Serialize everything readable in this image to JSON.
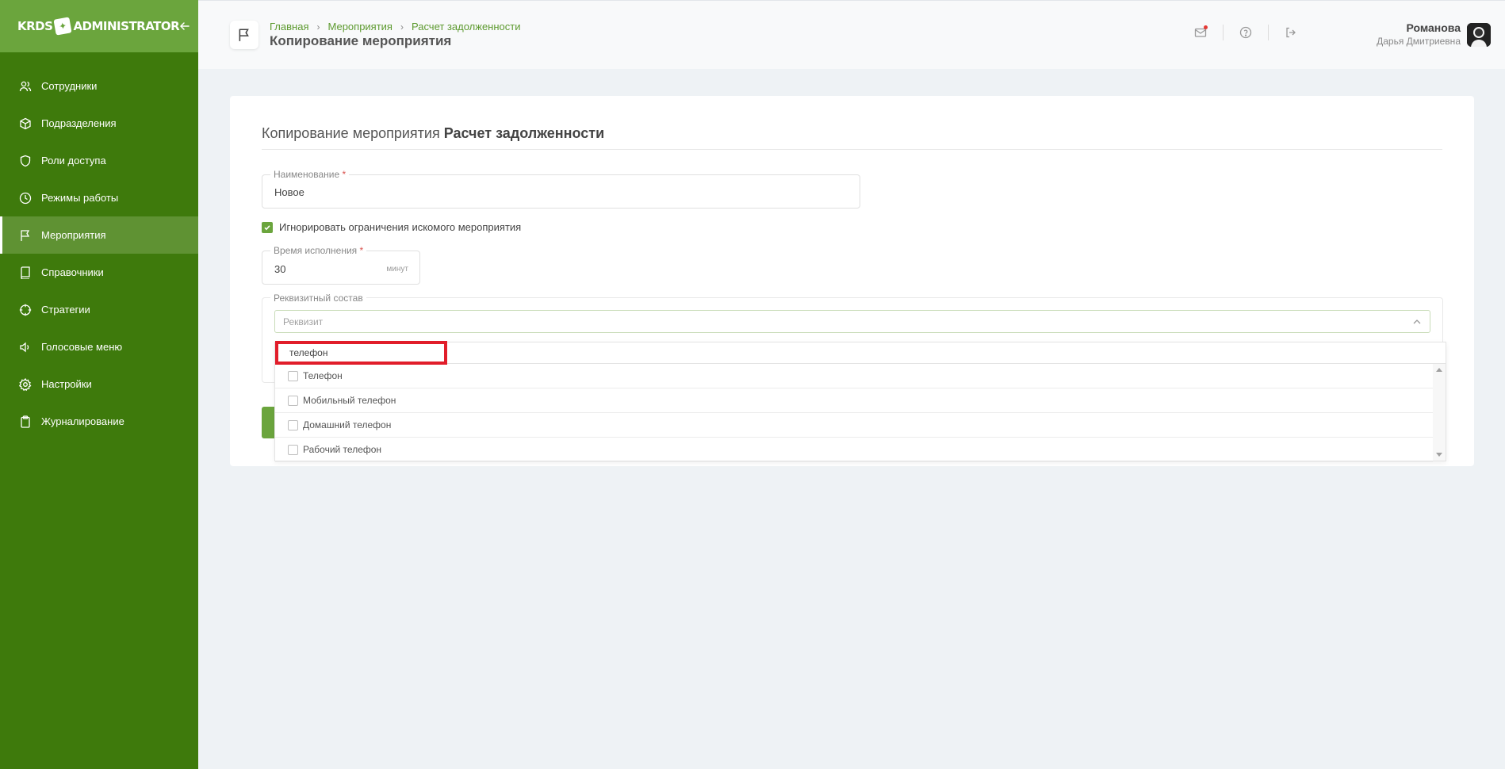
{
  "app": {
    "logo_left": "KRDS",
    "logo_right": "ADMINISTRATOR"
  },
  "sidebar": {
    "items": [
      {
        "label": "Сотрудники",
        "icon": "users-icon"
      },
      {
        "label": "Подразделения",
        "icon": "cube-icon"
      },
      {
        "label": "Роли доступа",
        "icon": "shield-icon"
      },
      {
        "label": "Режимы работы",
        "icon": "clock-icon"
      },
      {
        "label": "Мероприятия",
        "icon": "flag-icon",
        "active": true
      },
      {
        "label": "Справочники",
        "icon": "book-icon"
      },
      {
        "label": "Стратегии",
        "icon": "crosshair-icon"
      },
      {
        "label": "Голосовые меню",
        "icon": "speaker-icon"
      },
      {
        "label": "Настройки",
        "icon": "gear-icon"
      },
      {
        "label": "Журналирование",
        "icon": "clipboard-icon"
      }
    ]
  },
  "header": {
    "breadcrumbs": [
      "Главная",
      "Мероприятия",
      "Расчет задолженности"
    ],
    "title": "Копирование мероприятия",
    "user_surname": "Романова",
    "user_name": "Дарья Дмитриевна"
  },
  "form": {
    "title_prefix": "Копирование мероприятия",
    "title_bold": "Расчет задолженности",
    "name_label": "Наименование",
    "name_value": "Новое",
    "required_mark": "*",
    "ignore_label": "Игнорировать ограничения искомого мероприятия",
    "ignore_checked": true,
    "time_label": "Время исполнения",
    "time_value": "30",
    "time_unit": "минут",
    "props_legend": "Реквизитный состав",
    "props_placeholder": "Реквизит"
  },
  "dropdown": {
    "search_value": "телефон",
    "options": [
      "Телефон",
      "Мобильный телефон",
      "Домашний телефон",
      "Рабочий телефон"
    ]
  },
  "colors": {
    "sidebar_bg": "#3e7a0c",
    "sidebar_header": "#6ba53d",
    "accent": "#6ba53d",
    "link": "#5d9a2f",
    "highlight": "#e11d2a"
  }
}
